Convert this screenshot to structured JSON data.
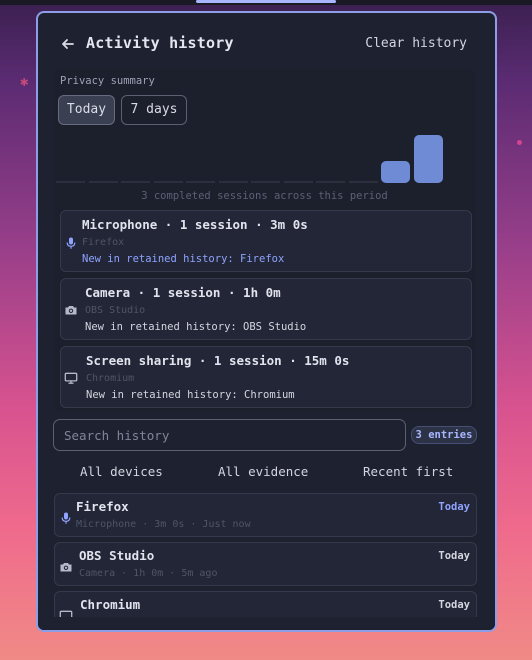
{
  "window": {
    "title": "Activity history",
    "clear_label": "Clear history"
  },
  "summary": {
    "label": "Privacy summary",
    "ranges": [
      {
        "label": "Today",
        "selected": true
      },
      {
        "label": "7 days",
        "selected": false
      }
    ],
    "chart_caption": "3 completed sessions across this period",
    "chart_levels": [
      0,
      0,
      0,
      0,
      0,
      0,
      0,
      0,
      0,
      0,
      0.45,
      1.0
    ]
  },
  "cards": [
    {
      "icon": "microphone-icon",
      "title": "Microphone · 1 session · 3m 0s",
      "app": "Firefox",
      "new_text": "New in retained history: Firefox",
      "new_highlight": true
    },
    {
      "icon": "camera-icon",
      "title": "Camera · 1 session · 1h 0m",
      "app": "OBS Studio",
      "new_text": "New in retained history: OBS Studio",
      "new_highlight": false
    },
    {
      "icon": "monitor-icon",
      "title": "Screen sharing · 1 session · 15m 0s",
      "app": "Chromium",
      "new_text": "New in retained history: Chromium",
      "new_highlight": false
    }
  ],
  "search": {
    "placeholder": "Search history",
    "entries_badge": "3 entries"
  },
  "filters": {
    "devices": "All devices",
    "evidence": "All evidence",
    "sort": "Recent first"
  },
  "history": [
    {
      "icon": "microphone-icon",
      "title": "Firefox",
      "sub": "Microphone · 3m 0s · Just now",
      "badge": "Today",
      "badge_accent": true
    },
    {
      "icon": "camera-icon",
      "title": "OBS Studio",
      "sub": "Camera · 1h 0m · 5m ago",
      "badge": "Today",
      "badge_accent": false
    },
    {
      "icon": "monitor-icon",
      "title": "Chromium",
      "sub": "",
      "badge": "Today",
      "badge_accent": false
    }
  ],
  "colors": {
    "accent": "#8fa3ff",
    "bar": "#6f8bd6",
    "panel_border": "#8d9ee6"
  }
}
